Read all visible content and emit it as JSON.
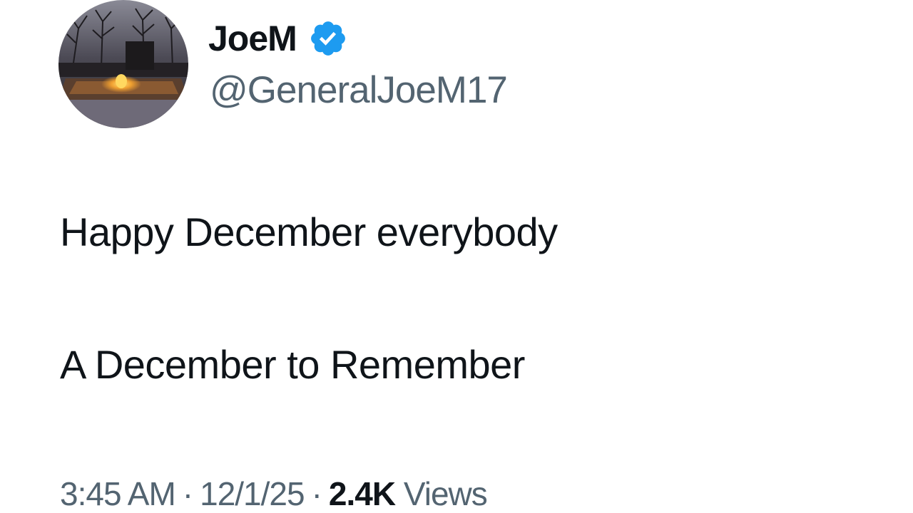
{
  "author": {
    "display_name": "JoeM",
    "handle": "@GeneralJoeM17",
    "avatar_icon": "avatar-photo",
    "verified_icon": "verified-badge-icon",
    "verified_color": "#1d9bf0"
  },
  "tweet": {
    "lines": [
      "Happy December everybody",
      "A December to Remember"
    ]
  },
  "meta": {
    "time": "3:45 AM",
    "separator": "·",
    "date": "12/1/25",
    "views_count": "2.4K",
    "views_label": "Views"
  },
  "colors": {
    "text_primary": "#0f1419",
    "text_secondary": "#536471",
    "background": "#ffffff"
  }
}
